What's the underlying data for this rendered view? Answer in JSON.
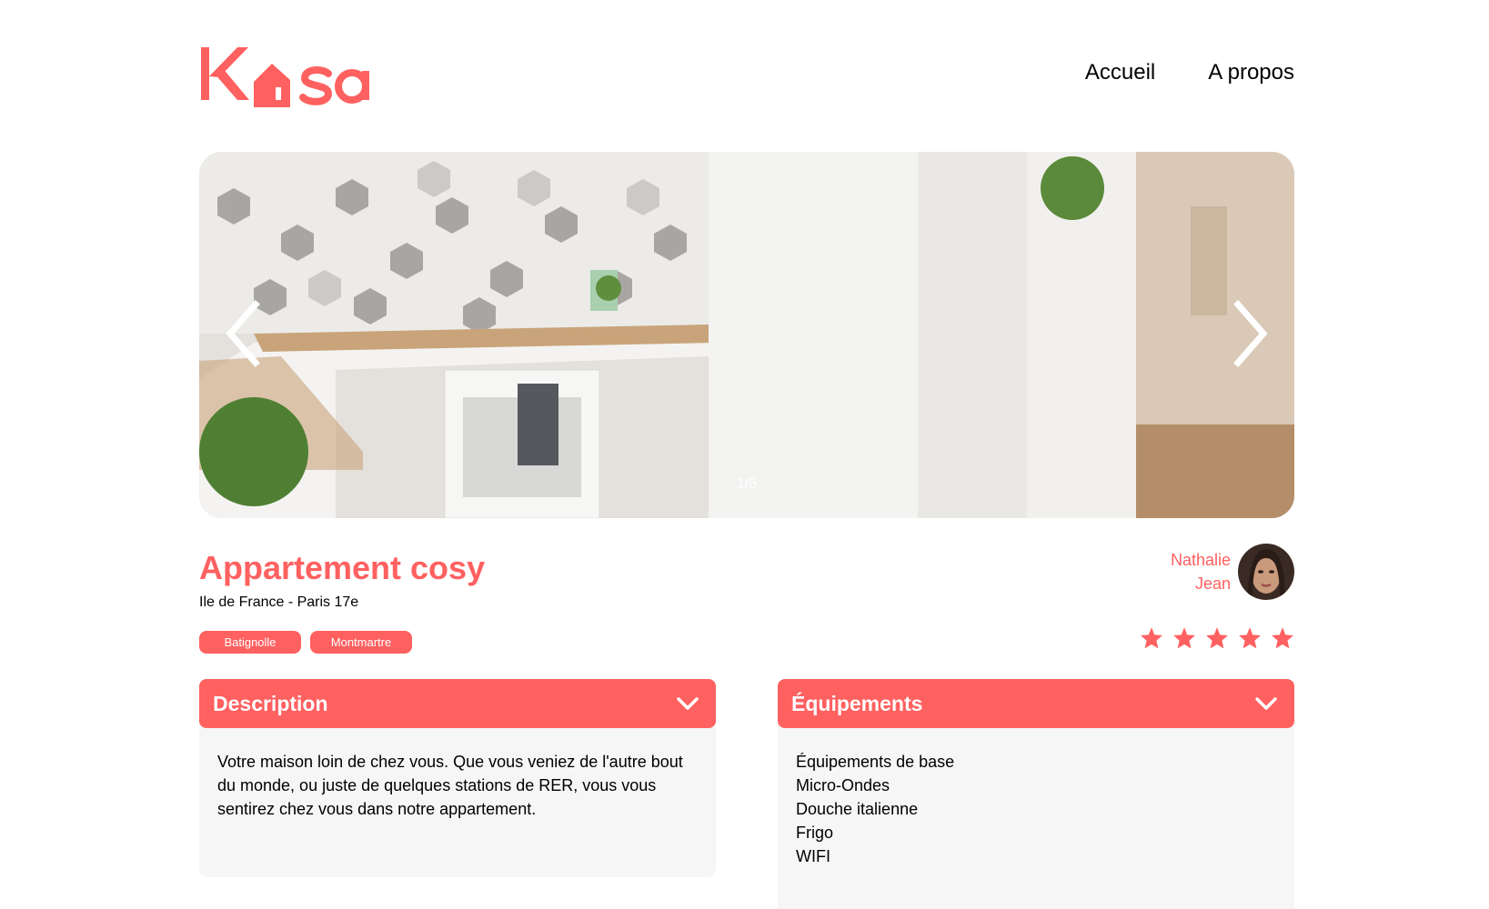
{
  "brand": {
    "logo_text": "Kasa",
    "accent_color": "#ff6060"
  },
  "nav": {
    "home": "Accueil",
    "about": "A propos"
  },
  "carousel": {
    "counter": "1/5",
    "prev_icon": "chevron-left-icon",
    "next_icon": "chevron-right-icon"
  },
  "listing": {
    "title": "Appartement cosy",
    "location": "Ile de France - Paris 17e",
    "tags": [
      "Batignolle",
      "Montmartre"
    ],
    "rating": 5,
    "rating_max": 5
  },
  "host": {
    "first_name": "Nathalie",
    "last_name": "Jean"
  },
  "description": {
    "title": "Description",
    "text": "Votre maison loin de chez vous. Que vous veniez de l'autre bout du monde, ou juste de quelques stations de RER, vous vous sentirez chez vous dans notre appartement."
  },
  "equipments": {
    "title": "Équipements",
    "items": [
      "Équipements de base",
      "Micro-Ondes",
      "Douche italienne",
      "Frigo",
      "WIFI"
    ]
  }
}
